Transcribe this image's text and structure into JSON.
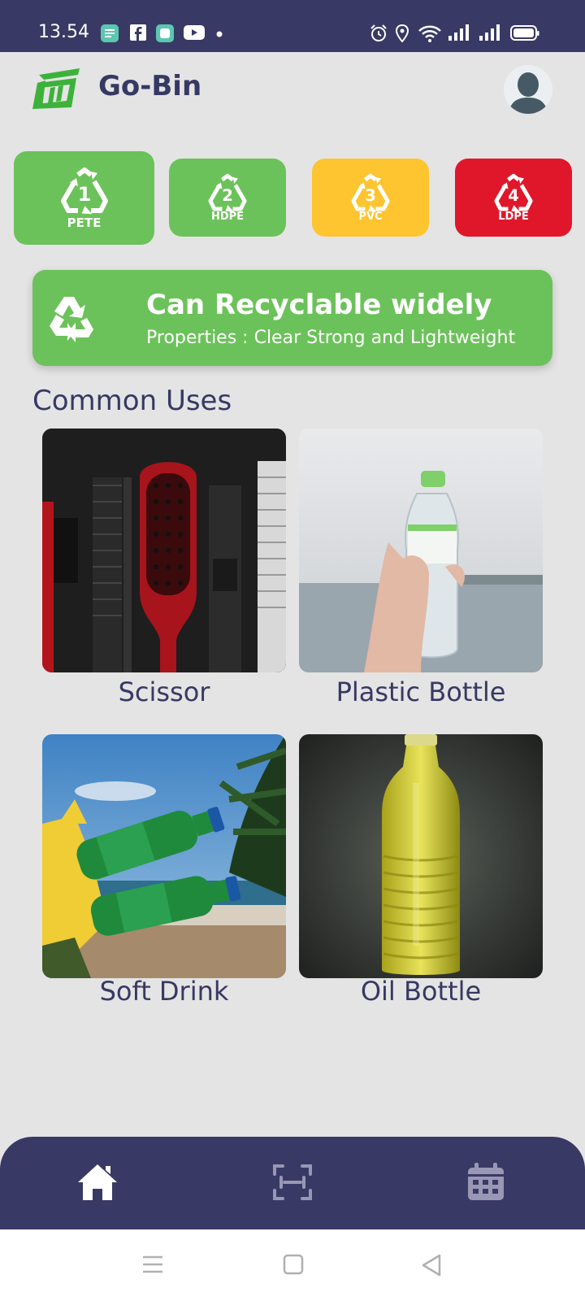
{
  "status_bar": {
    "time": "13.54",
    "notification_icons": [
      "notes-app-icon",
      "facebook-icon",
      "app-icon",
      "youtube-icon",
      "dot-icon"
    ],
    "system_icons": [
      "alarm-icon",
      "location-icon",
      "wifi-icon",
      "signal-icon",
      "signal-icon",
      "battery-icon"
    ]
  },
  "header": {
    "title": "Go-Bin",
    "logo_icon": "go-bin-logo-icon",
    "avatar_icon": "user-avatar-icon"
  },
  "plastic_types": [
    {
      "number": "1",
      "label": "PETE",
      "color": "#6cc25a",
      "selected": true
    },
    {
      "number": "2",
      "label": "HDPE",
      "color": "#6cc25a",
      "selected": false
    },
    {
      "number": "3",
      "label": "PVC",
      "color": "#fec531",
      "selected": false
    },
    {
      "number": "4",
      "label": "LDPE",
      "color": "#e0172a",
      "selected": false
    }
  ],
  "banner": {
    "icon": "recycle-icon",
    "title": "Can Recyclable widely",
    "subtitle": "Properties : Clear Strong and Lightweight",
    "color": "#6cc25a"
  },
  "section": {
    "title": "Common Uses"
  },
  "uses": [
    {
      "label": "Scissor",
      "image": "combs-and-brush-photo"
    },
    {
      "label": "Plastic Bottle",
      "image": "water-bottle-photo"
    },
    {
      "label": "Soft Drink",
      "image": "sprite-bottles-photo"
    },
    {
      "label": "Oil Bottle",
      "image": "oil-bottle-photo"
    }
  ],
  "bottom_nav": {
    "items": [
      {
        "icon": "home-icon",
        "active": true
      },
      {
        "icon": "scan-icon",
        "active": false
      },
      {
        "icon": "calendar-icon",
        "active": false
      }
    ],
    "color": "#393965"
  },
  "system_nav": {
    "items": [
      "menu-icon",
      "home-square-icon",
      "back-icon"
    ]
  }
}
